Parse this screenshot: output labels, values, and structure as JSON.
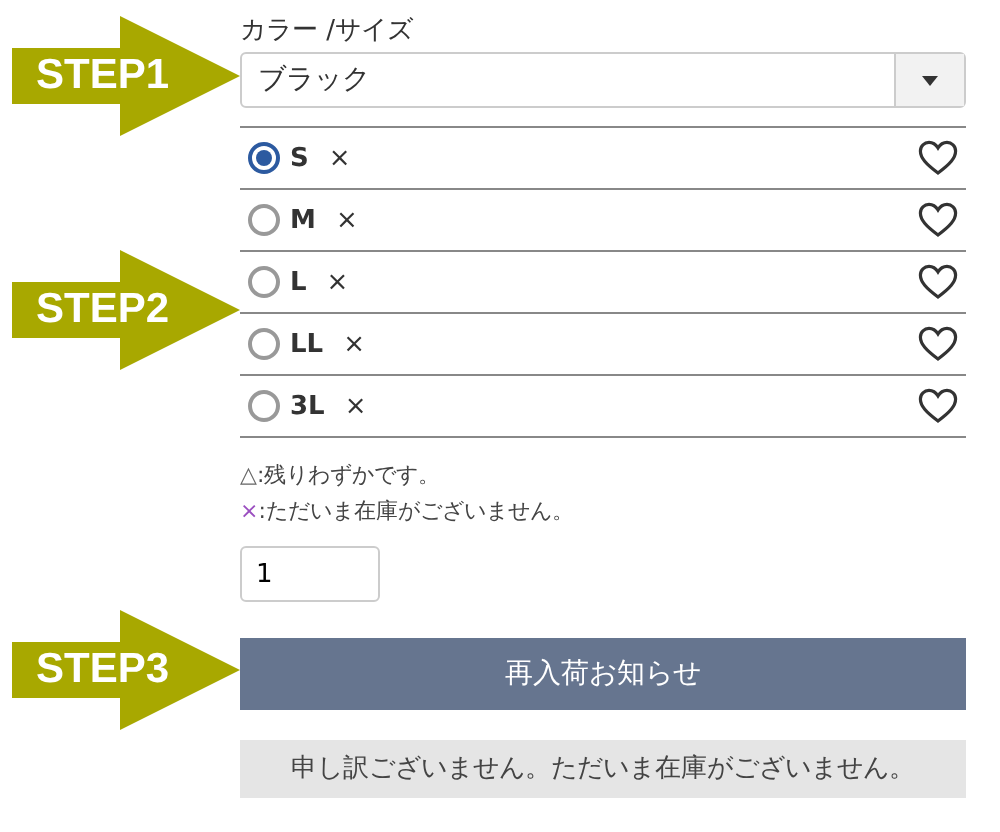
{
  "steps": [
    {
      "label": "STEP1"
    },
    {
      "label": "STEP2"
    },
    {
      "label": "STEP3"
    }
  ],
  "variant": {
    "label": "カラー /サイズ",
    "value": "ブラック"
  },
  "sizes": [
    {
      "label": "S",
      "stock": "×",
      "selected": true
    },
    {
      "label": "M",
      "stock": "×",
      "selected": false
    },
    {
      "label": "L",
      "stock": "×",
      "selected": false
    },
    {
      "label": "LL",
      "stock": "×",
      "selected": false
    },
    {
      "label": "3L",
      "stock": "×",
      "selected": false
    }
  ],
  "legend": [
    {
      "mark": "△",
      "text": ":残りわずかです。",
      "color": "#666666"
    },
    {
      "mark": "×",
      "text": ":ただいま在庫がございません。",
      "color": "#9b4fc0"
    }
  ],
  "quantity": {
    "value": "1"
  },
  "button": "再入荷お知らせ",
  "message": "申し訳ございません。ただいま在庫がございません。"
}
